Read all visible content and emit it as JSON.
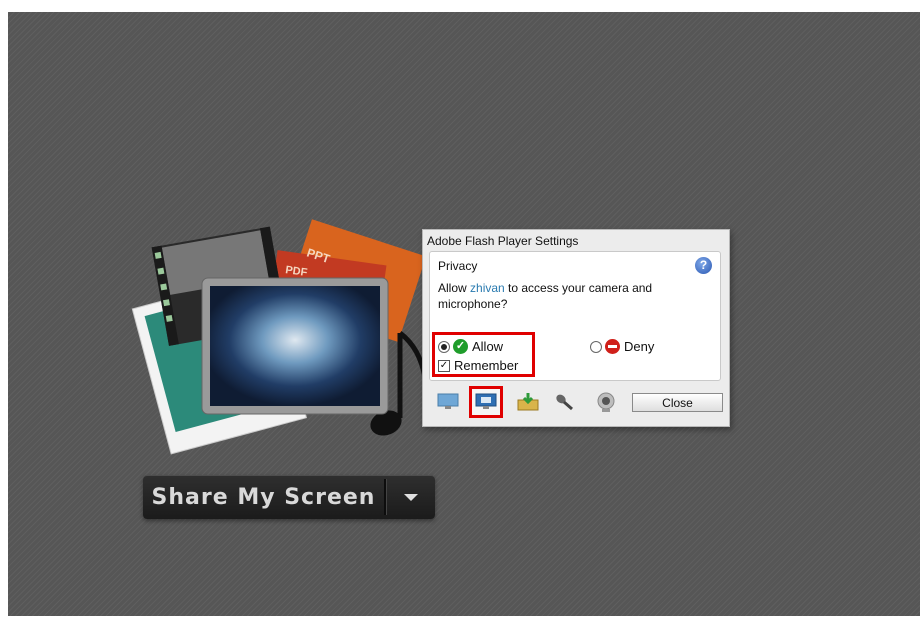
{
  "share_button": {
    "label": "Share My Screen"
  },
  "media": {
    "labels": [
      "PPT",
      "PDF"
    ]
  },
  "flash_dialog": {
    "title": "Adobe Flash Player Settings",
    "section_title": "Privacy",
    "message_prefix": "Allow ",
    "site": "zhivan",
    "message_suffix": " to access your camera and microphone?",
    "allow_label": "Allow",
    "deny_label": "Deny",
    "remember_label": "Remember",
    "close_label": "Close",
    "selected_option": "Allow",
    "remember_checked": true,
    "help_icon": "?",
    "tabs": [
      "display-icon",
      "privacy-icon",
      "storage-icon",
      "microphone-icon",
      "camera-icon"
    ]
  },
  "colors": {
    "highlight": "#e00000",
    "allow": "#1f9d2b",
    "deny": "#d0201a",
    "link": "#2a7bb0"
  }
}
